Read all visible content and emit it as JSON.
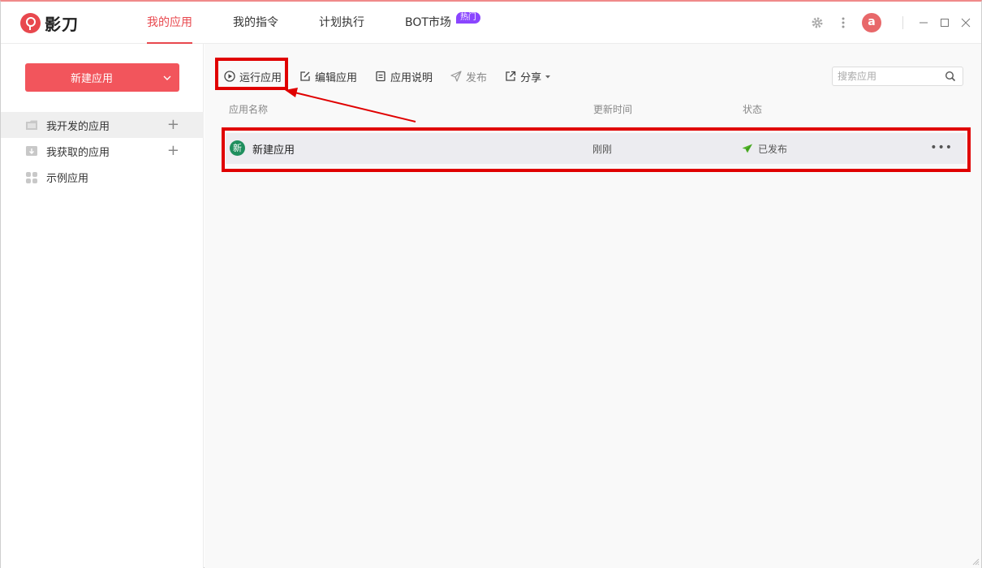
{
  "app": {
    "name": "影刀"
  },
  "nav": {
    "tabs": [
      {
        "label": "我的应用"
      },
      {
        "label": "我的指令"
      },
      {
        "label": "计划执行"
      },
      {
        "label": "BOT市场",
        "badge": "热门"
      }
    ]
  },
  "user": {
    "avatar_letter": "a"
  },
  "sidebar": {
    "new_app_label": "新建应用",
    "items": [
      {
        "label": "我开发的应用",
        "icon": "folder-icon"
      },
      {
        "label": "我获取的应用",
        "icon": "download-box-icon"
      },
      {
        "label": "示例应用",
        "icon": "grid-icon"
      }
    ]
  },
  "toolbar": {
    "run": "运行应用",
    "edit": "编辑应用",
    "desc": "应用说明",
    "publish": "发布",
    "share": "分享"
  },
  "search": {
    "placeholder": "搜索应用"
  },
  "table": {
    "headers": {
      "name": "应用名称",
      "time": "更新时间",
      "status": "状态"
    },
    "rows": [
      {
        "badge": "新",
        "name": "新建应用",
        "time": "刚刚",
        "status": "已发布"
      }
    ]
  },
  "colors": {
    "accent": "#e8484e",
    "badge_purple": "#8a45ff",
    "row_badge": "#1f8f5e",
    "annotation": "#e00000"
  }
}
